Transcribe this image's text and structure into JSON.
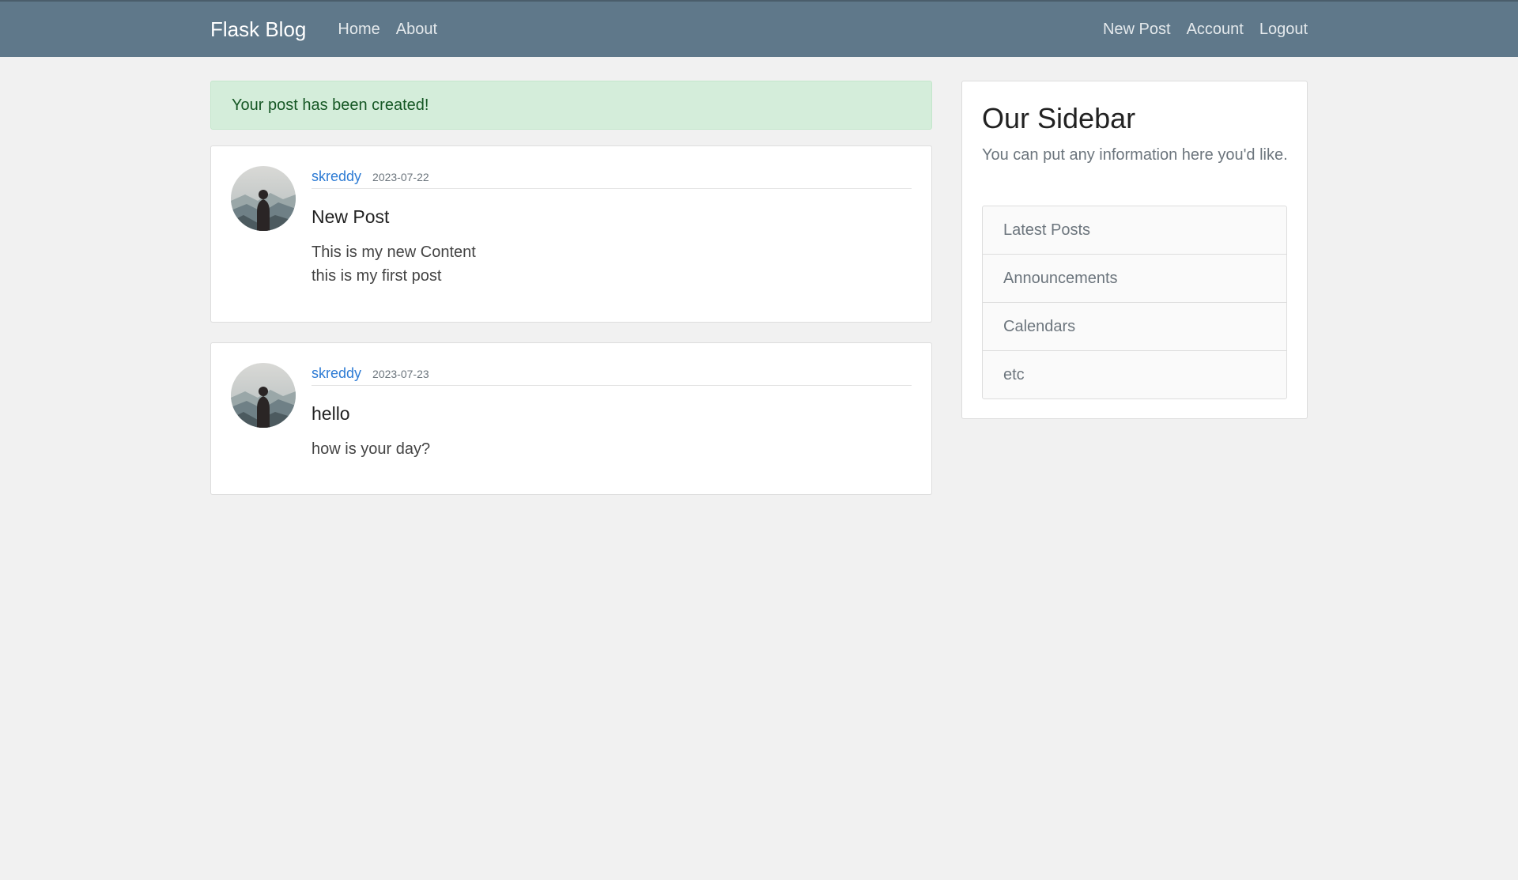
{
  "navbar": {
    "brand": "Flask Blog",
    "left_links": [
      "Home",
      "About"
    ],
    "right_links": [
      "New Post",
      "Account",
      "Logout"
    ]
  },
  "alert": {
    "message": "Your post has been created!"
  },
  "posts": [
    {
      "author": "skreddy",
      "date": "2023-07-22",
      "title": "New Post",
      "content_lines": [
        "This is my new Content",
        "this is my first post"
      ]
    },
    {
      "author": "skreddy",
      "date": "2023-07-23",
      "title": "hello",
      "content_lines": [
        "how is your day?"
      ]
    }
  ],
  "sidebar": {
    "title": "Our Sidebar",
    "text": "You can put any information here you'd like.",
    "items": [
      "Latest Posts",
      "Announcements",
      "Calendars",
      "etc"
    ]
  }
}
